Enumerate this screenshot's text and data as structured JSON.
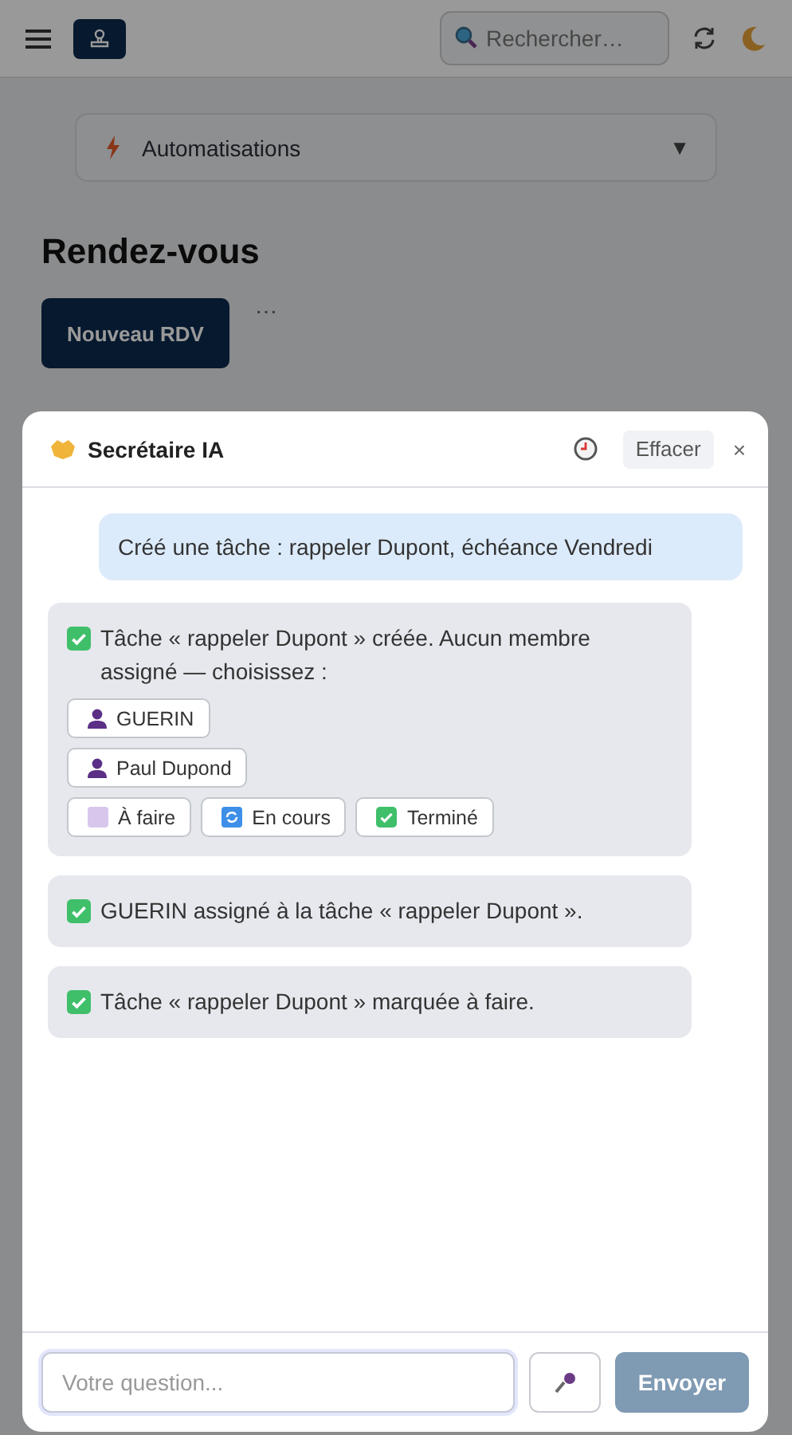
{
  "topbar": {
    "search": {
      "placeholder": "Rechercher…"
    }
  },
  "automations": {
    "label": "Automatisations",
    "toggle": "▼"
  },
  "page": {
    "title": "Rendez-vous",
    "primary_button": "Nouveau RDV",
    "more": "⋯"
  },
  "chat": {
    "title": "Secrétaire IA",
    "clear_button": "Effacer",
    "close": "×",
    "messages": [
      {
        "kind": "user",
        "text": "Créé une tâche : rappeler Dupont, échéance Vendredi"
      },
      {
        "kind": "bot",
        "text": "Tâche « rappeler Dupont » créée. Aucun membre assigné — choisissez :",
        "members": [
          "GUERIN",
          "Paul Dupond"
        ],
        "statuses": [
          {
            "kind": "todo",
            "label": "À faire"
          },
          {
            "kind": "progress",
            "label": "En cours"
          },
          {
            "kind": "done",
            "label": "Terminé"
          }
        ]
      },
      {
        "kind": "bot",
        "text": "GUERIN assigné à la tâche « rappeler Dupont »."
      },
      {
        "kind": "bot",
        "text": "Tâche « rappeler Dupont » marquée à faire."
      }
    ],
    "input": {
      "placeholder": "Votre question..."
    },
    "send": {
      "label": "Envoyer",
      "disabled": true
    }
  }
}
